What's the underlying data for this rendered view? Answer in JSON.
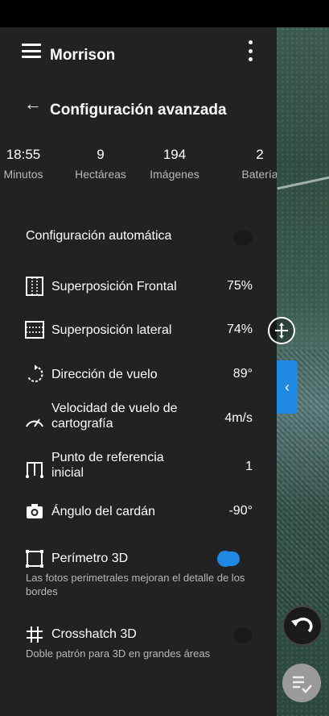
{
  "header": {
    "app_title": "Morrison",
    "screen_title": "Configuración avanzada"
  },
  "stats": [
    {
      "value": "18:55",
      "label": "Minutos"
    },
    {
      "value": "9",
      "label": "Hectáreas"
    },
    {
      "value": "194",
      "label": "Imágenes"
    },
    {
      "value": "2",
      "label": "Batería"
    }
  ],
  "auto_config": {
    "label": "Configuración automática",
    "enabled": false
  },
  "settings": [
    {
      "icon": "frontal-overlap-icon",
      "label": "Superposición Frontal",
      "value": "75%"
    },
    {
      "icon": "side-overlap-icon",
      "label": "Superposición lateral",
      "value": "74%"
    },
    {
      "icon": "rotate-direction-icon",
      "label": "Dirección de vuelo",
      "value": "89°"
    },
    {
      "icon": "speedometer-icon",
      "label": "Velocidad de vuelo de cartografía",
      "value": "4m/s"
    },
    {
      "icon": "waypoint-icon",
      "label": "Punto de referencia inicial",
      "value": "1"
    },
    {
      "icon": "camera-icon",
      "label": "Ángulo del cardán",
      "value": "-90°"
    }
  ],
  "perimeter": {
    "label": "Perímetro 3D",
    "description": "Las fotos perimetrales mejoran el detalle de los bordes",
    "enabled": true
  },
  "crosshatch": {
    "label": "Crosshatch 3D",
    "description": "Doble patrón para 3D en grandes áreas",
    "enabled": false
  },
  "colors": {
    "accent": "#1e88e5",
    "panel": "#222222"
  }
}
